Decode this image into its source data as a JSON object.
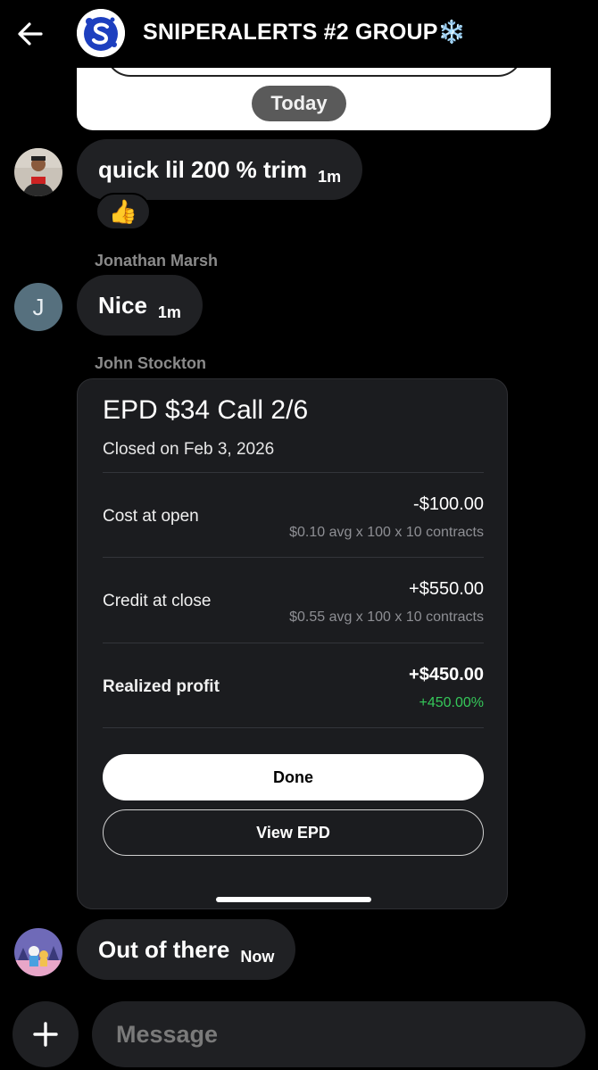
{
  "header": {
    "title": "SNIPERALERTS #2 GROUP",
    "title_emoji": "❄️"
  },
  "top_card": {
    "date_chip": "Today"
  },
  "messages": [
    {
      "text": "quick lil 200 % trim",
      "time": "1m",
      "reaction": "👍"
    },
    {
      "sender": "Jonathan Marsh",
      "avatar_initial": "J",
      "text": "Nice",
      "time": "1m"
    },
    {
      "sender": "John Stockton"
    },
    {
      "text": "Out of there",
      "time": "Now"
    }
  ],
  "trade_card": {
    "title": "EPD $34 Call 2/6",
    "subtitle": "Closed on Feb 3, 2026",
    "rows": [
      {
        "label": "Cost at open",
        "value": "-$100.00",
        "detail": "$0.10 avg x 100 x 10 contracts"
      },
      {
        "label": "Credit at close",
        "value": "+$550.00",
        "detail": "$0.55 avg x 100 x 10 contracts"
      },
      {
        "label": "Realized profit",
        "value": "+$450.00",
        "detail": "+450.00%"
      }
    ],
    "done_label": "Done",
    "view_label": "View EPD"
  },
  "composer": {
    "placeholder": "Message"
  },
  "colors": {
    "background": "#000000",
    "bubble": "#202124",
    "card": "#1b1c1f",
    "profit_green": "#35c759"
  },
  "icons": [
    "back-arrow-icon",
    "snowflake-icon",
    "thumbs-up-icon",
    "plus-icon"
  ]
}
